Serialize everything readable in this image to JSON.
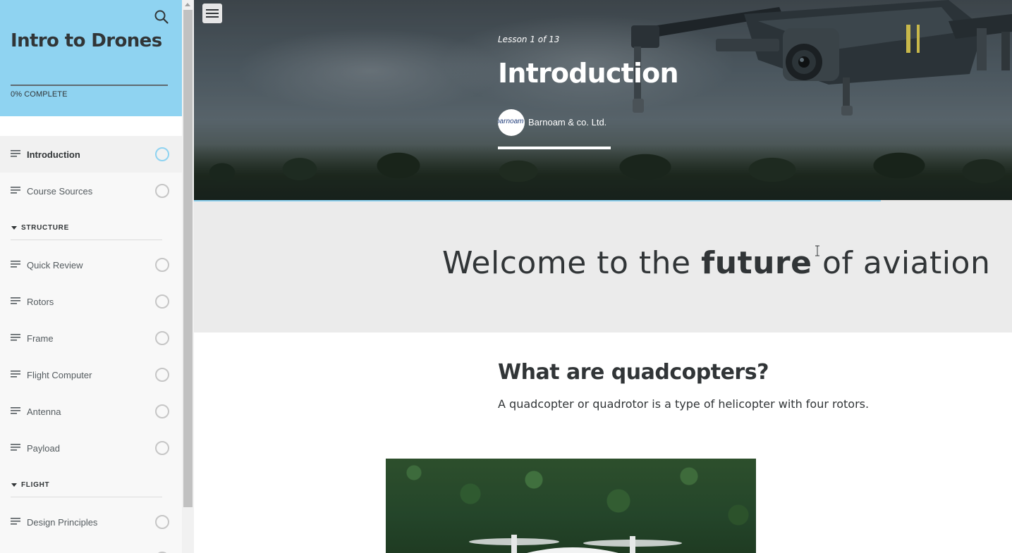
{
  "sidebar": {
    "course_title": "Intro to Drones",
    "progress_text": "0% COMPLETE",
    "progress_fraction": 0,
    "lessons": [
      {
        "label": "Introduction",
        "active": true
      },
      {
        "label": "Course Sources",
        "active": false
      }
    ],
    "sections": [
      {
        "title": "STRUCTURE",
        "lessons": [
          {
            "label": "Quick Review"
          },
          {
            "label": "Rotors"
          },
          {
            "label": "Frame"
          },
          {
            "label": "Flight Computer"
          },
          {
            "label": "Antenna"
          },
          {
            "label": "Payload"
          }
        ]
      },
      {
        "title": "FLIGHT",
        "lessons": [
          {
            "label": "Design Principles"
          }
        ]
      }
    ],
    "icons": {
      "search": "search-icon",
      "lesson": "lesson-lines-icon",
      "status": "status-circle-icon",
      "caret": "caret-down-icon"
    }
  },
  "hero": {
    "lesson_count": "Lesson 1 of 13",
    "lesson_title": "Introduction",
    "author_logo_text": "barnoam",
    "author_name": "Barnoam & co. Ltd.",
    "menu_icon": "hamburger-icon"
  },
  "banner": {
    "text_before": "Welcome to the ",
    "text_bold": "future",
    "text_after": " of aviation"
  },
  "content": {
    "heading": "What are quadcopters?",
    "paragraph": "A quadcopter or quadrotor is a type of helicopter with four rotors."
  },
  "colors": {
    "accent": "#8fd3f1",
    "text": "#313537",
    "banner_bg": "#ebebeb"
  }
}
